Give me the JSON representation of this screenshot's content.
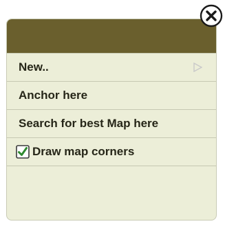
{
  "menu": {
    "items": [
      {
        "label": "New..",
        "has_submenu": true
      },
      {
        "label": "Anchor here"
      },
      {
        "label": "Search for best Map here"
      },
      {
        "label": "Draw map corners",
        "checked": true
      }
    ]
  },
  "colors": {
    "header": "#6a5f2d",
    "menu_background": "#eceed8",
    "checkbox_check": "#2f8a2f"
  },
  "icons": {
    "close": "close-icon",
    "submenu": "chevron-right-icon",
    "checkbox": "checkbox-checked-icon"
  }
}
